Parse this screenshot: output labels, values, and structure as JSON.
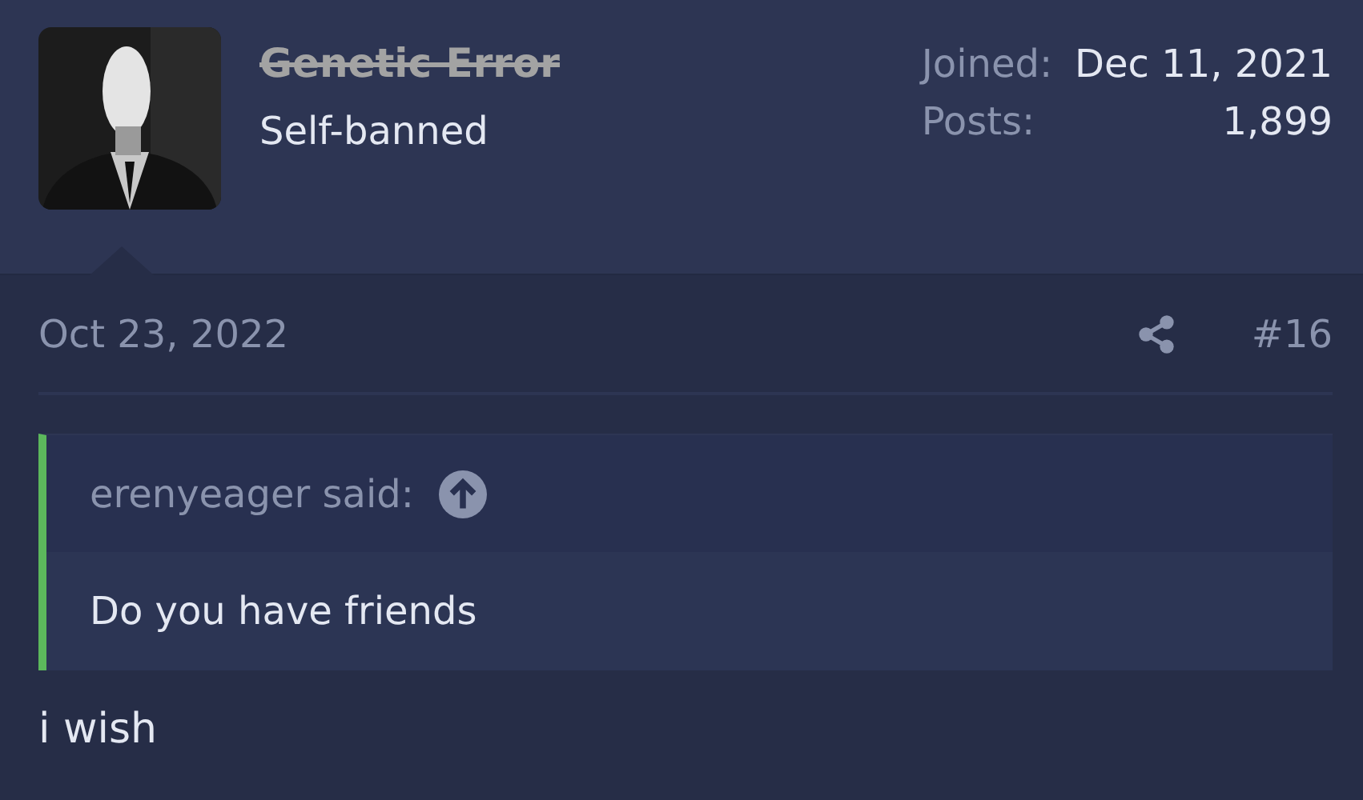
{
  "member": {
    "name": "Genetic Error",
    "banned": true,
    "title": "Self-banned"
  },
  "stats": [
    {
      "label": "Joined:",
      "value": "Dec 11, 2021"
    },
    {
      "label": "Posts:",
      "value": "1,899"
    }
  ],
  "post": {
    "date": "Oct 23, 2022",
    "number": "#16",
    "quote": {
      "author": "erenyeager said:",
      "text": "Do you have friends"
    },
    "body": "i wish"
  }
}
